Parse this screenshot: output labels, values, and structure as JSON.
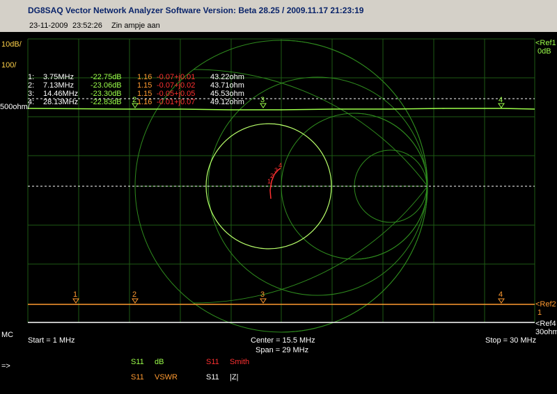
{
  "app": {
    "title": "DG8SAQ Vector Network Analyzer Software   Version:  Beta 28.25 / 2009.11.17 21:23:19"
  },
  "info": {
    "date": "23-11-2009",
    "time": "23:52:26",
    "name": "Zin ampje aan"
  },
  "left_labels": {
    "top": "10dB/",
    "second": "100/",
    "ohm": "500ohm/",
    "mc": "MC",
    "arrow": "=>"
  },
  "right_labels": {
    "ref1": "<Ref1",
    "ref1_val": "0dB",
    "ref2": "<Ref2",
    "ref2_val": "1",
    "ref4": "<Ref4",
    "ref4_val": "30ohm"
  },
  "markers": [
    {
      "idx": "1:",
      "freq": "3.75MHz",
      "db": "-22.75dB",
      "vswr": "1.16",
      "smith": "-0.07+j0.01",
      "z": "43.22ohm"
    },
    {
      "idx": "2:",
      "freq": "7.13MHz",
      "db": "-23.06dB",
      "vswr": "1.15",
      "smith": "-0.07+j0.02",
      "z": "43.71ohm"
    },
    {
      "idx": "3:",
      "freq": "14.46MHz",
      "db": "-23.30dB",
      "vswr": "1.15",
      "smith": "-0.05+j0.05",
      "z": "45.53ohm"
    },
    {
      "idx": "4:",
      "freq": "28.13MHz",
      "db": "-22.83dB",
      "vswr": "1.16",
      "smith": "-0.01+j0.07",
      "z": "49.12ohm"
    }
  ],
  "sweep": {
    "start": "Start = 1 MHz",
    "center": "Center = 15.5 MHz",
    "span": "Span = 29 MHz",
    "stop": "Stop = 30 MHz"
  },
  "traces": [
    {
      "param": "S11",
      "type": "dB",
      "color": "#9cff4a"
    },
    {
      "param": "S11",
      "type": "Smith",
      "color": "#ff3030"
    },
    {
      "param": "S11",
      "type": "VSWR",
      "color": "#ff9a30"
    },
    {
      "param": "S11",
      "type": "|Z|",
      "color": "#ffffff"
    }
  ],
  "marker_numbers": [
    "1",
    "2",
    "3",
    "4"
  ],
  "colors": {
    "grid": "#1e5a14",
    "db_trace": "#9cff4a",
    "smith_trace": "#ff3030",
    "vswr_trace": "#ff9a30",
    "z_trace": "#ffffff",
    "label_yellow": "#ffd24a"
  }
}
